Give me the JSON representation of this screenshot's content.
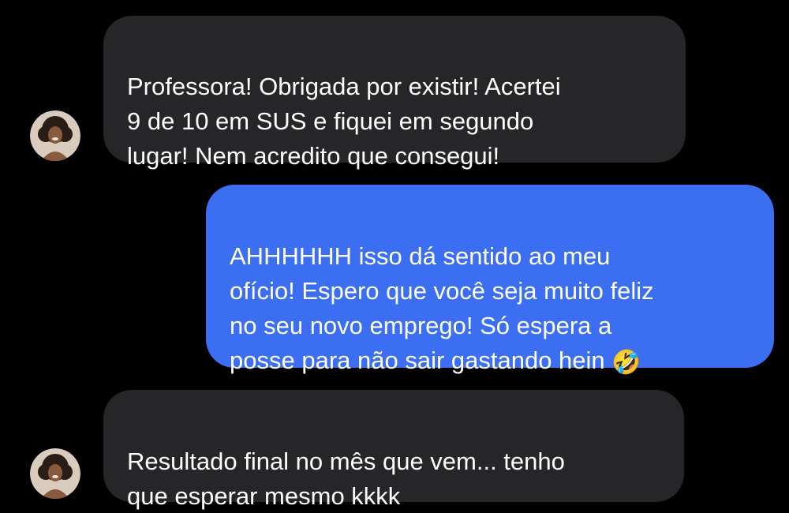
{
  "conversation": {
    "messages": [
      {
        "sender": "contact",
        "text": "Professora! Obrigada por existir! Acertei\n9 de 10 em SUS e fiquei em segundo\nlugar! Nem acredito que consegui!"
      },
      {
        "sender": "me",
        "text": "AHHHHHH isso dá sentido ao meu\nofício! Espero que você seja muito feliz\nno seu novo emprego! Só espera a\nposse para não sair gastando hein ",
        "emoji": "🤣"
      },
      {
        "sender": "contact",
        "text": "Resultado final no mês que vem... tenho\nque esperar mesmo kkkk"
      }
    ]
  },
  "colors": {
    "background": "#000000",
    "incoming_bubble": "#262628",
    "outgoing_bubble": "#3b6ef0",
    "text": "#ffffff"
  },
  "icons": {
    "contact_avatar": "contact-avatar-photo",
    "laughing_emoji": "rolling-on-floor-laughing-emoji"
  }
}
